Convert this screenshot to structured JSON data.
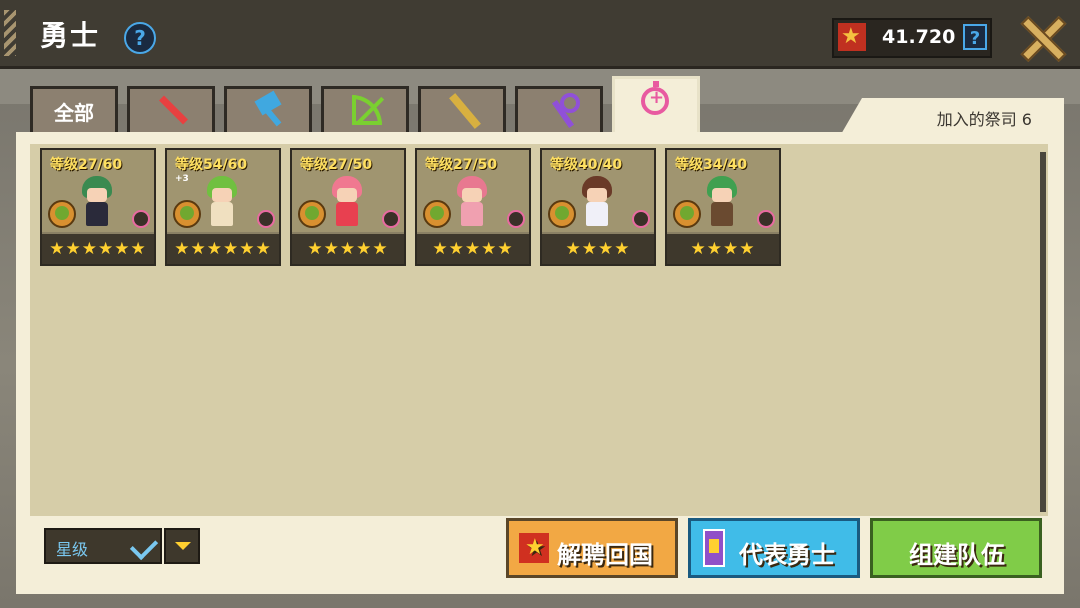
{
  "header": {
    "title": "勇士",
    "help": "?"
  },
  "currency": {
    "value": "41.720",
    "help": "?"
  },
  "tabs": [
    {
      "label": "全部",
      "icon": null
    },
    {
      "icon": "sword"
    },
    {
      "icon": "hammer"
    },
    {
      "icon": "bow"
    },
    {
      "icon": "gun"
    },
    {
      "icon": "staff"
    },
    {
      "icon": "priest",
      "active": true
    }
  ],
  "joined_label": "加入的祭司 6",
  "heroes": [
    {
      "level": "等级27/60",
      "stars": "★★★★★★",
      "hair": "#3a8a50",
      "body": "#2a2a3a",
      "plus": ""
    },
    {
      "level": "等级54/60",
      "stars": "★★★★★★",
      "hair": "#70c040",
      "body": "#f0e0c0",
      "plus": "+3"
    },
    {
      "level": "等级27/50",
      "stars": "★★★★★",
      "hair": "#f07890",
      "body": "#e84050",
      "plus": ""
    },
    {
      "level": "等级27/50",
      "stars": "★★★★★",
      "hair": "#e87890",
      "body": "#f0a0b0",
      "plus": ""
    },
    {
      "level": "等级40/40",
      "stars": "★★★★",
      "hair": "#6a3a28",
      "body": "#f0f0f8",
      "plus": ""
    },
    {
      "level": "等级34/40",
      "stars": "★★★★",
      "hair": "#40a050",
      "body": "#6a4a30",
      "plus": ""
    }
  ],
  "sort": {
    "label": "星级"
  },
  "buttons": {
    "dismiss": "解聘回国",
    "represent": "代表勇士",
    "team": "组建队伍"
  }
}
